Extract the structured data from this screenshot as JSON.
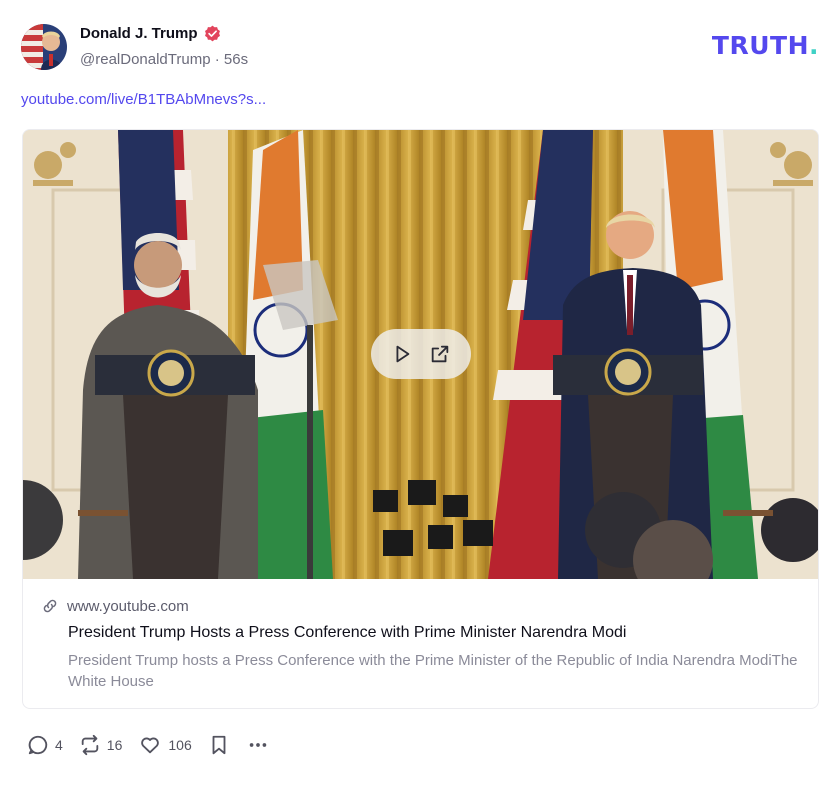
{
  "post": {
    "author_name": "Donald J. Trump",
    "handle": "@realDonaldTrump",
    "separator": "·",
    "time_ago": "56s",
    "link_text": "youtube.com/live/B1TBAbMnevs?s..."
  },
  "brand": {
    "logo_text": "TRUTH",
    "logo_dot": ".",
    "accent_color": "#5448ee",
    "dot_color": "#3fd1c5"
  },
  "card": {
    "domain": "www.youtube.com",
    "title": "President Trump Hosts a Press Conference with Prime Minister Narendra Modi",
    "description": "President Trump hosts a Press Conference with the Prime Minister of the Republic of India Narendra ModiThe White House",
    "media_controls": [
      "play-icon",
      "external-link-icon"
    ]
  },
  "actions": {
    "replies": "4",
    "reposts": "16",
    "likes": "106"
  },
  "icons": {
    "verified": "verified-badge-icon",
    "reply": "reply-icon",
    "repost": "repost-icon",
    "like": "heart-icon",
    "bookmark": "bookmark-icon",
    "more": "more-icon",
    "link": "link-icon"
  }
}
